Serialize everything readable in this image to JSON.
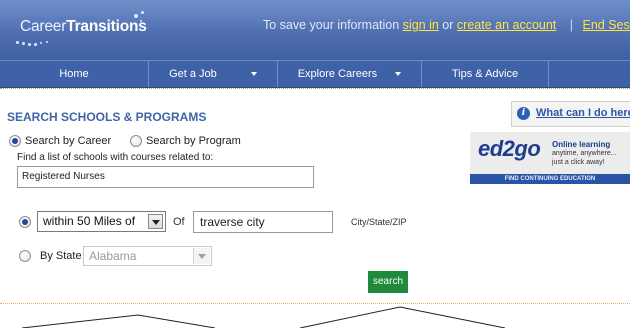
{
  "header": {
    "logo_part1": "Career",
    "logo_part2": "Transitions",
    "message_prefix": "To save your information",
    "sign_in_link": "sign in",
    "message_or": "or",
    "create_account_link": "create an account",
    "separator": "|",
    "end_session_link": "End Sessio"
  },
  "nav": {
    "items": [
      {
        "label": "Home"
      },
      {
        "label": "Get a Job"
      },
      {
        "label": "Explore Careers"
      },
      {
        "label": "Tips & Advice"
      }
    ]
  },
  "search": {
    "title": "SEARCH SCHOOLS & PROGRAMS",
    "by_career_label": "Search by Career",
    "by_program_label": "Search by Program",
    "prompt": "Find a list of schools with courses related to:",
    "career_value": "Registered Nurses",
    "distance_value": "within 50 Miles of",
    "of_label": "Of",
    "location_value": "traverse city",
    "location_hint": "City/State/ZIP",
    "by_state_label": "By State",
    "state_value": "Alabama",
    "search_button": "search"
  },
  "help": {
    "link_label": "What can I do here?",
    "icon_glyph": "i"
  },
  "ad": {
    "logo": "ed2go",
    "tagline1": "Online learning",
    "tagline2": "anytime, anywhere...",
    "tagline3": "just a click away!",
    "bar_text": "FIND CONTINUING EDUCATION"
  },
  "colors": {
    "brand_blue": "#3f61a7",
    "title_blue": "#3f65a8",
    "link_yellow": "#ffe640",
    "search_green": "#1f8a3b"
  }
}
